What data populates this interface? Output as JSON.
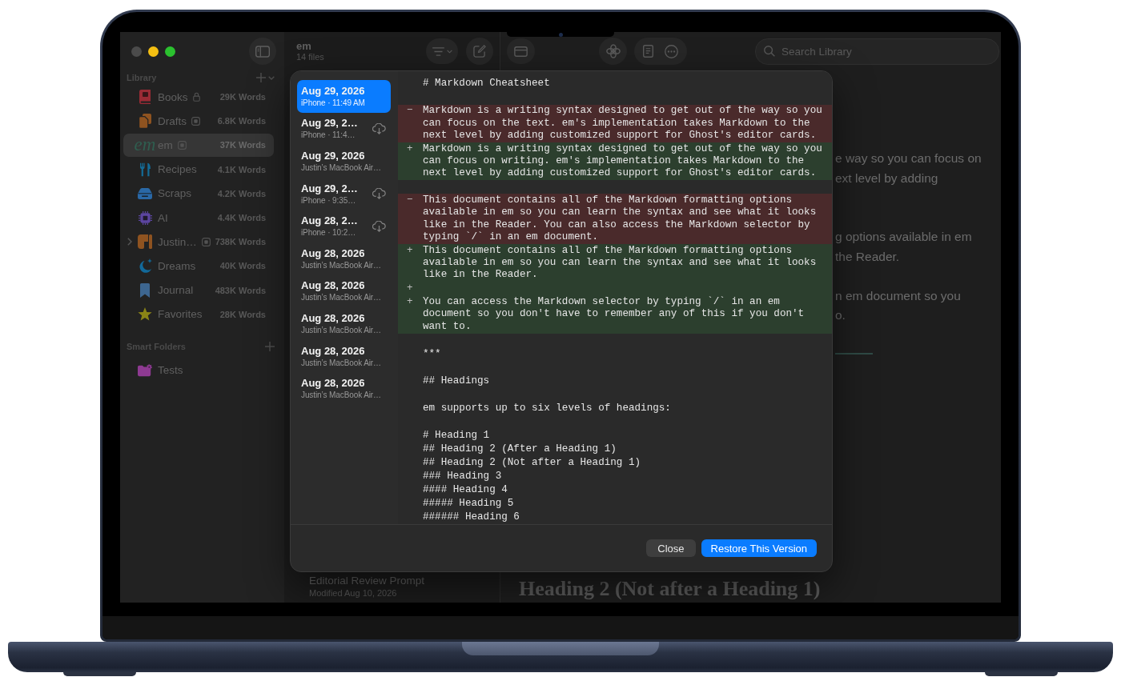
{
  "sidebar": {
    "sections": [
      {
        "title": "Library",
        "items": [
          {
            "label": "Books",
            "count": "29K Words",
            "color": "#9a2b35",
            "locked": true,
            "shared": false,
            "expandable": false,
            "selected": false
          },
          {
            "label": "Drafts",
            "count": "6.8K Words",
            "color": "#8f5320",
            "locked": false,
            "shared": true,
            "expandable": false,
            "selected": false
          },
          {
            "label": "em",
            "logo": "em",
            "count": "37K Words",
            "color": "#2f5e4f",
            "locked": false,
            "shared": true,
            "expandable": false,
            "selected": true
          },
          {
            "label": "Recipes",
            "count": "4.1K Words",
            "color": "#146b96",
            "locked": false,
            "shared": false,
            "expandable": false,
            "selected": false
          },
          {
            "label": "Scraps",
            "count": "4.2K Words",
            "color": "#2a68a6",
            "locked": false,
            "shared": false,
            "expandable": false,
            "selected": false
          },
          {
            "label": "AI",
            "count": "4.4K Words",
            "color": "#5c45a0",
            "locked": false,
            "shared": false,
            "expandable": false,
            "selected": false
          },
          {
            "label": "Justin…",
            "count": "738K Words",
            "color": "#8f5320",
            "locked": false,
            "shared": true,
            "expandable": true,
            "selected": false
          },
          {
            "label": "Dreams",
            "count": "40K Words",
            "color": "#12699a",
            "locked": false,
            "shared": false,
            "expandable": false,
            "selected": false
          },
          {
            "label": "Journal",
            "count": "483K Words",
            "color": "#3d6690",
            "locked": false,
            "shared": false,
            "expandable": false,
            "selected": false
          },
          {
            "label": "Favorites",
            "count": "28K Words",
            "color": "#8a8416",
            "locked": false,
            "shared": false,
            "expandable": false,
            "selected": false
          }
        ]
      },
      {
        "title": "Smart Folders",
        "items": [
          {
            "label": "Tests",
            "color": "#8e3a92",
            "locked": false,
            "shared": false,
            "expandable": false,
            "selected": false
          }
        ]
      }
    ]
  },
  "file_list": {
    "title": "em",
    "subtitle": "14 files",
    "notes": [
      {
        "title": "Editorial Review Prompt",
        "modified": "Modified Aug 10, 2026"
      }
    ]
  },
  "toolbar": {
    "search": {
      "placeholder": "Search Library"
    }
  },
  "editor": {
    "paragraphs": [
      {
        "lines": [
          "e way so you can focus on",
          "ext level by adding"
        ]
      },
      {
        "lines": [
          "g options available in em",
          "the Reader."
        ]
      },
      {
        "lines": [
          "n em document so you",
          "o."
        ]
      }
    ],
    "heading": "Heading 2 (Not after a Heading 1)"
  },
  "version_sheet": {
    "versions": [
      {
        "title": "Aug 29, 2026",
        "device": "iPhone · 11:49 AM",
        "in_cloud": false,
        "selected": true
      },
      {
        "title": "Aug 29, 2…",
        "device": "iPhone · 11:4…",
        "in_cloud": true,
        "selected": false
      },
      {
        "title": "Aug 29, 2026",
        "device": "Justin’s MacBook Air…",
        "in_cloud": false,
        "selected": false
      },
      {
        "title": "Aug 29, 2…",
        "device": "iPhone · 9:35…",
        "in_cloud": true,
        "selected": false
      },
      {
        "title": "Aug 28, 2…",
        "device": "iPhone · 10:2…",
        "in_cloud": true,
        "selected": false
      },
      {
        "title": "Aug 28, 2026",
        "device": "Justin’s MacBook Air…",
        "in_cloud": false,
        "selected": false
      },
      {
        "title": "Aug 28, 2026",
        "device": "Justin’s MacBook Air…",
        "in_cloud": false,
        "selected": false
      },
      {
        "title": "Aug 28, 2026",
        "device": "Justin’s MacBook Air…",
        "in_cloud": false,
        "selected": false
      },
      {
        "title": "Aug 28, 2026",
        "device": "Justin’s MacBook Air…",
        "in_cloud": false,
        "selected": false
      },
      {
        "title": "Aug 28, 2026",
        "device": "Justin’s MacBook Air…",
        "in_cloud": false,
        "selected": false
      }
    ],
    "diff": [
      {
        "kind": "context",
        "text": "# Markdown Cheatsheet"
      },
      {
        "kind": "blank"
      },
      {
        "kind": "removed",
        "marker": "−",
        "text": "Markdown is a writing syntax designed to get out of the way so you can focus on the text. em's implementation takes Markdown to the next level by adding customized support for Ghost's editor cards."
      },
      {
        "kind": "added",
        "marker": "+",
        "text": "Markdown is a writing syntax designed to get out of the way so you can focus on writing. em's implementation takes Markdown to the next level by adding customized support for Ghost's editor cards."
      },
      {
        "kind": "blank"
      },
      {
        "kind": "removed",
        "marker": "−",
        "text": "This document contains all of the Markdown formatting options available in em so you can learn the syntax and see what it looks like in the Reader. You can also access the Markdown selector by typing `/` in an em document."
      },
      {
        "kind": "added",
        "marker": "+",
        "text": "This document contains all of the Markdown formatting options available in em so you can learn the syntax and see what it looks like in the Reader."
      },
      {
        "kind": "added",
        "marker": "+"
      },
      {
        "kind": "added",
        "marker": "+",
        "text": "You can access the Markdown selector by typing `/` in an em document so you don't have to remember any of this if you don't want to."
      },
      {
        "kind": "blank"
      },
      {
        "kind": "context",
        "text": "***"
      },
      {
        "kind": "blank"
      },
      {
        "kind": "context",
        "text": "## Headings"
      },
      {
        "kind": "blank"
      },
      {
        "kind": "context",
        "text": "em supports up to six levels of headings:"
      },
      {
        "kind": "blank"
      },
      {
        "kind": "context",
        "text": "# Heading 1"
      },
      {
        "kind": "context",
        "text": "## Heading 2 (After a Heading 1)"
      },
      {
        "kind": "context",
        "text": "## Heading 2 (Not after a Heading 1)"
      },
      {
        "kind": "context",
        "text": "### Heading 3"
      },
      {
        "kind": "context",
        "text": "#### Heading 4"
      },
      {
        "kind": "context",
        "text": "##### Heading 5"
      },
      {
        "kind": "context",
        "text": "###### Heading 6"
      }
    ],
    "buttons": [
      {
        "label": "Close",
        "kind": "secondary"
      },
      {
        "label": "Restore This Version",
        "kind": "primary"
      }
    ]
  }
}
